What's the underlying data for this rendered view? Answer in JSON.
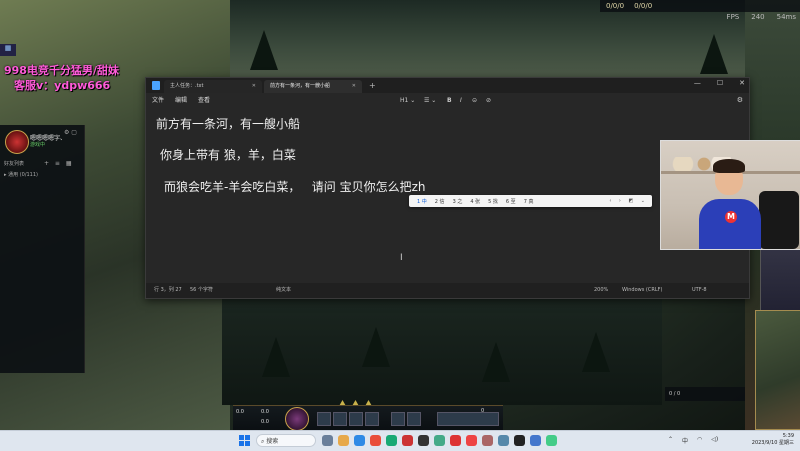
{
  "game_hud": {
    "top_stats": [
      "0/0/0",
      "0/0/0"
    ],
    "fps_label": "FPS",
    "fps_value": "240",
    "ping": "54ms",
    "score_text": "0 / 0"
  },
  "overlay": {
    "line1": "998电竞千分猛男/甜妹",
    "line2": "客服v：ydpw666"
  },
  "friend_panel": {
    "name": "嗯嗯嗯嗯字、",
    "status": "游戏中",
    "section": "好友列表",
    "group": "▸ 通用 (0/111)"
  },
  "notepad": {
    "tabs": [
      {
        "label": "主人任务：.txt"
      },
      {
        "label": "前方有一条河，有一艘小船"
      }
    ],
    "add_tab": "+",
    "window_controls": [
      "—",
      "☐",
      "✕"
    ],
    "menu": [
      "文件",
      "编辑",
      "查看"
    ],
    "format": [
      "H1 ⌄",
      "☰ ⌄",
      "B",
      "I",
      "⊝",
      "⊘"
    ],
    "lines": [
      "前方有一条河，有一艘小船",
      "你身上带有 狼，羊，白菜",
      "而狼会吃羊-羊会吃白菜，   请问 宝贝你怎么把zh"
    ],
    "ime_candidates": [
      "1 中",
      "2 信",
      "3 之",
      "4 张",
      "5 找",
      "6 至",
      "7 真"
    ],
    "ime_tail": "‹ › ◩ ⌄",
    "status": {
      "position": "行 3，列 27",
      "chars": "56 个字符",
      "format": "纯文本",
      "zoom": "200%",
      "line_ending": "Windows (CRLF)",
      "encoding": "UTF-8"
    }
  },
  "webcam": {
    "logo": "M"
  },
  "bottom_hud": {
    "stat1": "0.0",
    "stat2": "0.0",
    "stat3": "0.0",
    "gold": "0"
  },
  "taskbar": {
    "search": "搜索",
    "time": "5:39",
    "date": "2023/9/10 星期三",
    "tray_text": "中"
  },
  "colors": {
    "overlay_pink": "#ff5bd9",
    "notepad_bg": "#272727",
    "taskbar_bg": "#dfe6ef",
    "accent_blue": "#1a73e8"
  }
}
